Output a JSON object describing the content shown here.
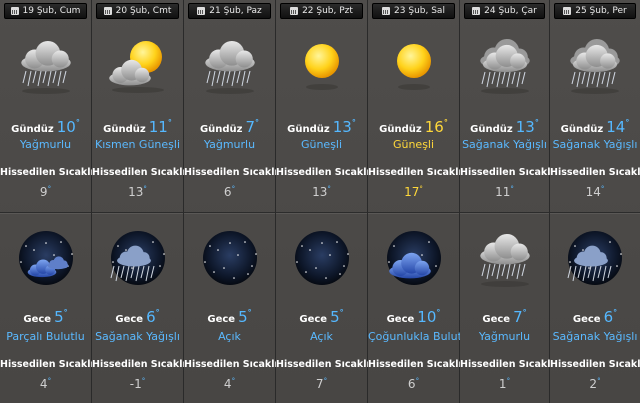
{
  "labels": {
    "day": "Gündüz",
    "night": "Gece",
    "feels_like": "Hissedilen Sıcaklık",
    "degree": "°"
  },
  "colors": {
    "accent": "#55b8ff",
    "hot": "#ffd83a",
    "background": "#4a4846",
    "header": "#1a1a1a"
  },
  "days": [
    {
      "date": "19 Şub, Cum",
      "day_icon": "rain-cloud-icon",
      "day_temp": "10",
      "day_cond": "Yağmurlu",
      "day_feel": "9",
      "night_icon": "partly-cloudy-night-icon",
      "night_temp": "5",
      "night_cond": "Parçalı Bulutlu",
      "night_feel": "4",
      "hot": false
    },
    {
      "date": "20 Şub, Cmt",
      "day_icon": "partly-sunny-icon",
      "day_temp": "11",
      "day_cond": "Kısmen Güneşli",
      "day_feel": "13",
      "night_icon": "rain-night-icon",
      "night_temp": "6",
      "night_cond": "Sağanak Yağışlı",
      "night_feel": "-1",
      "hot": false
    },
    {
      "date": "21 Şub, Paz",
      "day_icon": "rain-cloud-icon",
      "day_temp": "7",
      "day_cond": "Yağmurlu",
      "day_feel": "6",
      "night_icon": "clear-night-icon",
      "night_temp": "5",
      "night_cond": "Açık",
      "night_feel": "4",
      "hot": false
    },
    {
      "date": "22 Şub, Pzt",
      "day_icon": "sun-icon",
      "day_temp": "13",
      "day_cond": "Güneşli",
      "day_feel": "13",
      "night_icon": "clear-night-icon",
      "night_temp": "5",
      "night_cond": "Açık",
      "night_feel": "7",
      "hot": false
    },
    {
      "date": "23 Şub, Sal",
      "day_icon": "sun-icon",
      "day_temp": "16",
      "day_cond": "Güneşli",
      "day_feel": "17",
      "night_icon": "cloudy-night-icon",
      "night_temp": "10",
      "night_cond": "Çoğunlukla Bulutlu",
      "night_feel": "6",
      "hot": true
    },
    {
      "date": "24 Şub, Çar",
      "day_icon": "shower-cloud-icon",
      "day_temp": "13",
      "day_cond": "Sağanak Yağışlı",
      "day_feel": "11",
      "night_icon": "rain-cloud-icon",
      "night_temp": "7",
      "night_cond": "Yağmurlu",
      "night_feel": "1",
      "hot": false
    },
    {
      "date": "25 Şub, Per",
      "day_icon": "shower-cloud-icon",
      "day_temp": "14",
      "day_cond": "Sağanak Yağışlı",
      "day_feel": "14",
      "night_icon": "rain-night-icon",
      "night_temp": "6",
      "night_cond": "Sağanak Yağışlı",
      "night_feel": "2",
      "hot": false
    }
  ]
}
